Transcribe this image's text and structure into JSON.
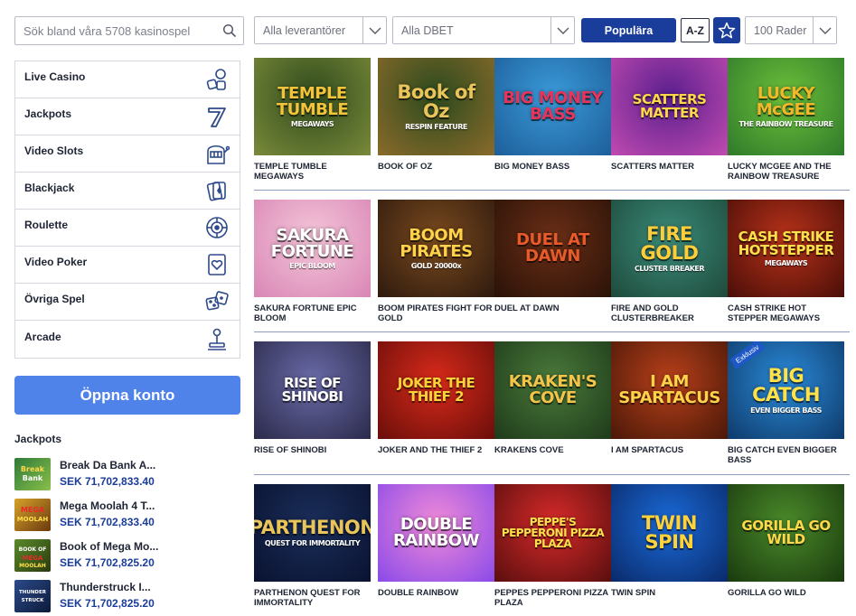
{
  "search": {
    "placeholder": "Sök bland våra 5708 kasinospel"
  },
  "filters": {
    "provider": "Alla leverantörer",
    "dbet": "Alla DBET",
    "popular_label": "Populära",
    "az_label": "A-Z",
    "rows": "100 Rader"
  },
  "categories": [
    {
      "label": "Live Casino",
      "icon": "live-casino-icon"
    },
    {
      "label": "Jackpots",
      "icon": "seven-icon"
    },
    {
      "label": "Video Slots",
      "icon": "slot-machine-icon"
    },
    {
      "label": "Blackjack",
      "icon": "cards-icon"
    },
    {
      "label": "Roulette",
      "icon": "roulette-icon"
    },
    {
      "label": "Video Poker",
      "icon": "heart-card-icon"
    },
    {
      "label": "Övriga Spel",
      "icon": "dice-icon"
    },
    {
      "label": "Arcade",
      "icon": "joystick-icon"
    }
  ],
  "open_account_label": "Öppna konto",
  "jackpots": {
    "title": "Jackpots",
    "items": [
      {
        "name": "Break Da Bank A...",
        "amount": "SEK 71,702,833.40"
      },
      {
        "name": "Mega Moolah 4 T...",
        "amount": "SEK 71,702,833.40"
      },
      {
        "name": "Book of Mega Mo...",
        "amount": "SEK 71,702,825.20"
      },
      {
        "name": "Thunderstruck I...",
        "amount": "SEK 71,702,825.20"
      }
    ]
  },
  "games": [
    {
      "name": "TEMPLE TUMBLE MEGAWAYS",
      "logo": "TEMPLE TUMBLE",
      "sub": "MEGAWAYS",
      "bg": [
        "#2f4a1c",
        "#7a8a3a"
      ],
      "fg": "#f3c43a"
    },
    {
      "name": "BOOK OF OZ",
      "logo": "Book of Oz",
      "sub": "RESPIN FEATURE",
      "bg": [
        "#2b4a1e",
        "#8a6a2a"
      ],
      "fg": "#e8c45a"
    },
    {
      "name": "BIG MONEY BASS",
      "logo": "BIG MONEY BASS",
      "sub": "",
      "bg": [
        "#3a9ad8",
        "#1d5e9a"
      ],
      "fg": "#e8345a"
    },
    {
      "name": "SCATTERS MATTER",
      "logo": "SCATTERS MATTER",
      "sub": "",
      "bg": [
        "#5a1f8e",
        "#c04ab0"
      ],
      "fg": "#ffd84a"
    },
    {
      "name": "LUCKY MCGEE AND THE RAINBOW TREASURE",
      "logo": "LUCKY McGEE",
      "sub": "THE RAINBOW TREASURE",
      "bg": [
        "#6cbf3a",
        "#2e7a2a"
      ],
      "fg": "#f2b82a"
    },
    {
      "name": "SAKURA FORTUNE EPIC BLOOM",
      "logo": "SAKURA FORTUNE",
      "sub": "EPIC BLOOM",
      "bg": [
        "#f4c6d8",
        "#d986b6"
      ],
      "fg": "#ffffff"
    },
    {
      "name": "BOOM PIRATES FIGHT FOR GOLD",
      "logo": "BOOM PIRATES",
      "sub": "GOLD 20000x",
      "bg": [
        "#7a4a1e",
        "#2e1a0e"
      ],
      "fg": "#ffd24a"
    },
    {
      "name": "DUEL AT DAWN",
      "logo": "DUEL AT DAWN",
      "sub": "",
      "bg": [
        "#6a2e16",
        "#2a1208"
      ],
      "fg": "#e85a2a"
    },
    {
      "name": "FIRE AND GOLD CLUSTERBREAKER",
      "logo": "FIRE GOLD",
      "sub": "CLUSTER BREAKER",
      "bg": [
        "#3a8a7a",
        "#1e4a3a"
      ],
      "fg": "#ffcc3a"
    },
    {
      "name": "CASH STRIKE HOT STEPPER MEGAWAYS",
      "logo": "CASH STRIKE HOTSTEPPER",
      "sub": "MEGAWAYS",
      "bg": [
        "#b8321a",
        "#4a0e08"
      ],
      "fg": "#ffe04a"
    },
    {
      "name": "RISE OF SHINOBI",
      "logo": "RISE OF SHINOBI",
      "sub": "",
      "bg": [
        "#6a6aa8",
        "#2a2a4a"
      ],
      "fg": "#ffffff"
    },
    {
      "name": "JOKER AND THE THIEF 2",
      "logo": "JOKER THE THIEF 2",
      "sub": "",
      "bg": [
        "#d82a1a",
        "#6a0e0a"
      ],
      "fg": "#ffd23a"
    },
    {
      "name": "KRAKENS COVE",
      "logo": "KRAKEN'S COVE",
      "sub": "",
      "bg": [
        "#4a7a3a",
        "#1e3a1a"
      ],
      "fg": "#f2c44a"
    },
    {
      "name": "I AM SPARTACUS",
      "logo": "I AM SPARTACUS",
      "sub": "",
      "bg": [
        "#b8401a",
        "#4a1808"
      ],
      "fg": "#ffd24a"
    },
    {
      "name": "BIG CATCH EVEN BIGGER BASS",
      "logo": "BIG CATCH",
      "sub": "EVEN BIGGER BASS",
      "bg": [
        "#2a8ad8",
        "#0e3a6a"
      ],
      "fg": "#ffe24a",
      "badge": "Exklusiv"
    },
    {
      "name": "PARTHENON QUEST FOR IMMORTALITY",
      "logo": "PARTHENON",
      "sub": "QUEST FOR IMMORTALITY",
      "bg": [
        "#1a2e5a",
        "#0a1230"
      ],
      "fg": "#e8c45a"
    },
    {
      "name": "DOUBLE RAINBOW",
      "logo": "DOUBLE RAINBOW",
      "sub": "",
      "bg": [
        "#f08ad8",
        "#8a4ae8"
      ],
      "fg": "#ffffff"
    },
    {
      "name": "PEPPES PEPPERONI PIZZA PLAZA",
      "logo": "PEPPE'S PEPPERONI PIZZA PLAZA",
      "sub": "",
      "bg": [
        "#d82a2a",
        "#5a0e0e"
      ],
      "fg": "#ffe04a"
    },
    {
      "name": "TWIN SPIN",
      "logo": "TWIN SPIN",
      "sub": "",
      "bg": [
        "#1a6ad8",
        "#0a2a6a"
      ],
      "fg": "#ffd23a"
    },
    {
      "name": "GORILLA GO WILD",
      "logo": "GORILLA GO WILD",
      "sub": "",
      "bg": [
        "#4a8a2a",
        "#1a3a0e"
      ],
      "fg": "#ffd84a"
    }
  ],
  "colors": {
    "brand_blue": "#1a3c9a",
    "cta_blue": "#4f83ea",
    "amount_blue": "#1a3c9a"
  }
}
